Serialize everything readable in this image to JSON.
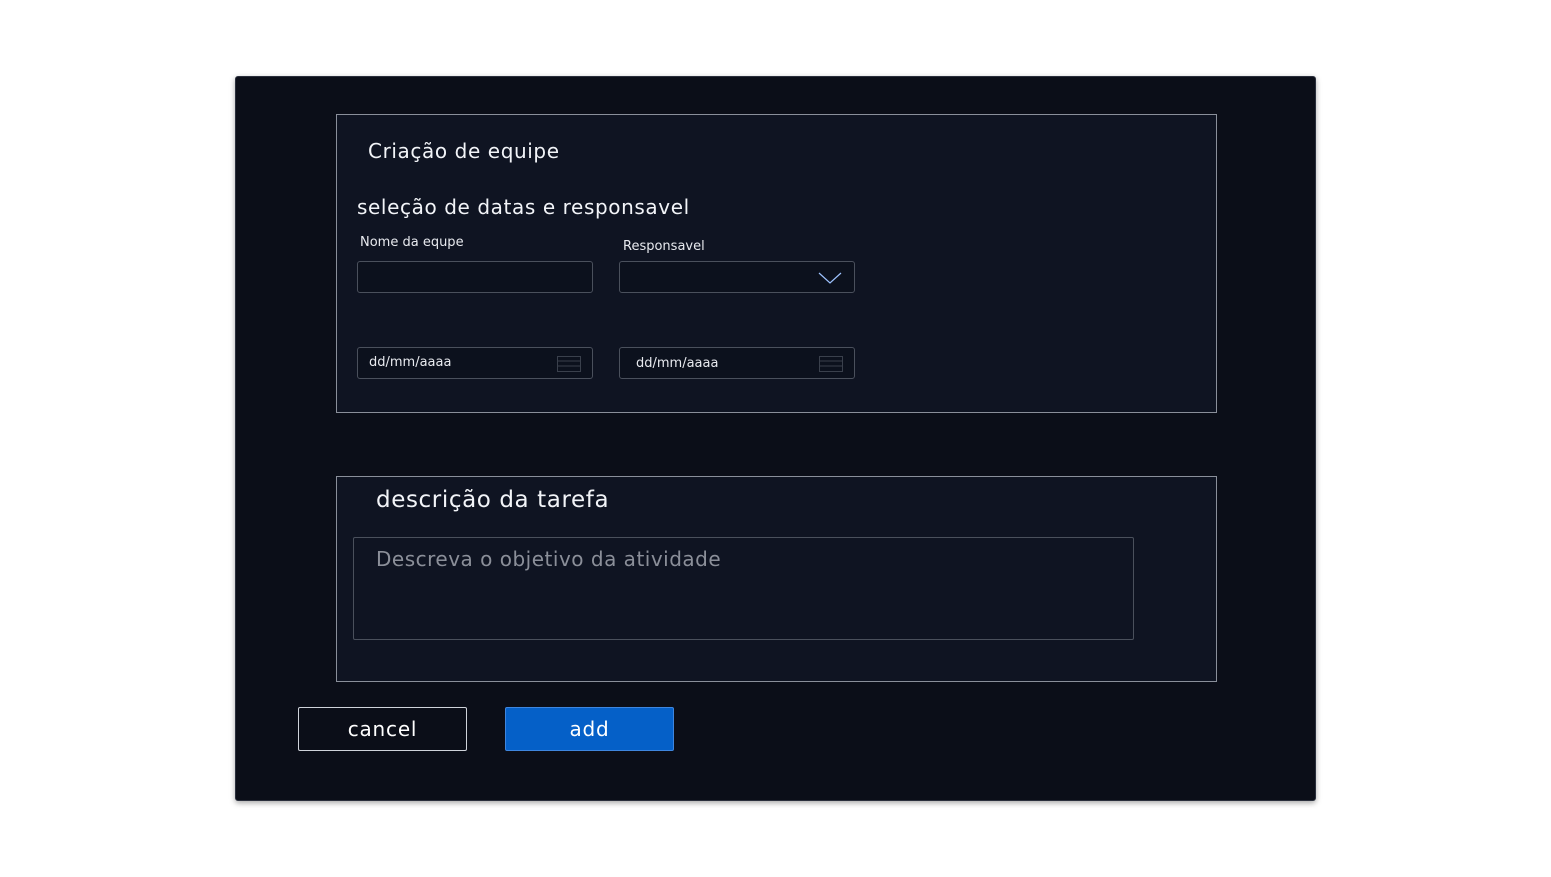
{
  "form": {
    "title": "Criação de equipe",
    "section_title": "seleção de datas e responsavel",
    "team_name": {
      "label": "Nome da equpe",
      "value": ""
    },
    "responsible": {
      "label": "Responsavel",
      "value": ""
    },
    "start_date": {
      "placeholder": "dd/mm/aaaa"
    },
    "end_date": {
      "placeholder": "dd/mm/aaaa"
    }
  },
  "description": {
    "title": "descrição da tarefa",
    "placeholder": "Descreva o objetivo da atividade"
  },
  "actions": {
    "cancel_label": "cancel",
    "add_label": "add"
  },
  "colors": {
    "modal_background": "#0b0e18",
    "panel_background": "#0f1422",
    "add_button": "#0560c8",
    "text": "#f2f4f8"
  },
  "icons": {
    "select": "chevron-down-icon",
    "date": "calendar-icon"
  }
}
